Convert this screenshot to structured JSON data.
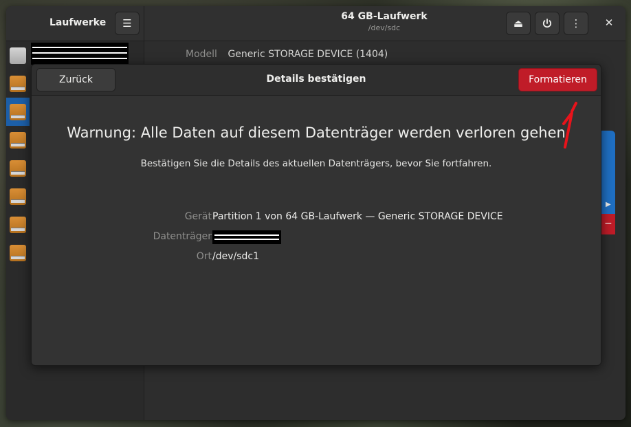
{
  "sidebar_header": {
    "title": "Laufwerke"
  },
  "header": {
    "title": "64 GB-Laufwerk",
    "subtitle": "/dev/sdc"
  },
  "background_panel": {
    "model_label": "Modell",
    "model_value": "Generic STORAGE DEVICE (1404)"
  },
  "dialog": {
    "back_label": "Zurück",
    "title": "Details bestätigen",
    "format_label": "Formatieren",
    "warning": "Warnung: Alle Daten auf diesem Datenträger werden verloren gehen",
    "subtext": "Bestätigen Sie die Details des aktuellen Datenträgers, bevor Sie fortfahren.",
    "details": {
      "device_label": "Gerät",
      "device_value": "Partition 1 von 64 GB-Laufwerk — Generic STORAGE DEVICE",
      "volume_label": "Datenträger",
      "location_label": "Ort",
      "location_value": "/dev/sdc1"
    }
  },
  "colors": {
    "destructive": "#c01c28",
    "selected": "#1c5fa8",
    "annotation": "#e8131b"
  }
}
